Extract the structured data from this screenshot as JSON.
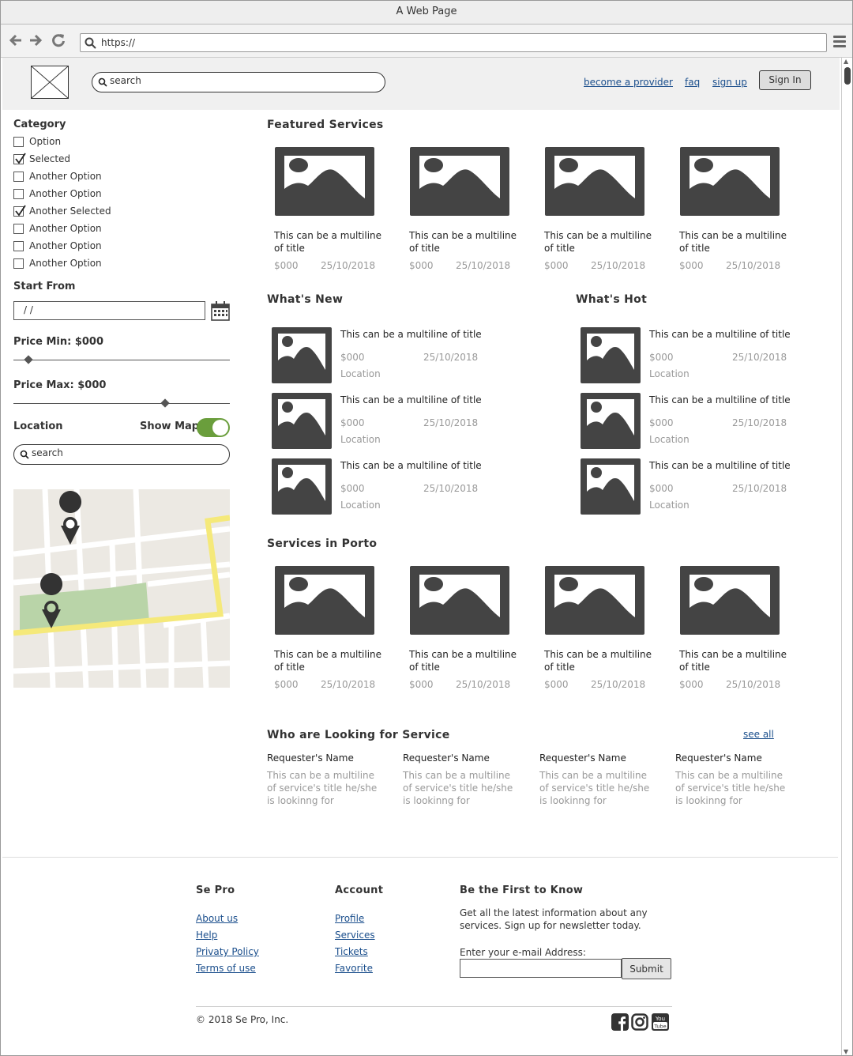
{
  "browser": {
    "title": "A Web Page",
    "url": "https://"
  },
  "header": {
    "search_placeholder": "search",
    "links": [
      "become a provider",
      "faq",
      "sign up"
    ],
    "signin_label": "Sign In"
  },
  "sidebar": {
    "category_heading": "Category",
    "options": [
      {
        "label": "Option",
        "checked": false
      },
      {
        "label": "Selected",
        "checked": true
      },
      {
        "label": "Another Option",
        "checked": false
      },
      {
        "label": "Another Option",
        "checked": false
      },
      {
        "label": "Another Selected",
        "checked": true
      },
      {
        "label": "Another Option",
        "checked": false
      },
      {
        "label": "Another Option",
        "checked": false
      },
      {
        "label": "Another Option",
        "checked": false
      }
    ],
    "start_from_heading": "Start From",
    "date_value": "/ /",
    "price_min_label": "Price Min: $000",
    "price_min_level": 0.07,
    "price_max_label": "Price Max: $000",
    "price_max_level": 0.7,
    "location_heading": "Location",
    "show_map_label": "Show Map",
    "show_map_on": true,
    "location_placeholder": "search"
  },
  "featured": {
    "heading": "Featured Services",
    "cards": [
      {
        "title": "This can be a multiline of title",
        "price": "$000",
        "date": "25/10/2018"
      },
      {
        "title": "This can be a multiline of title",
        "price": "$000",
        "date": "25/10/2018"
      },
      {
        "title": "This can be a multiline of title",
        "price": "$000",
        "date": "25/10/2018"
      },
      {
        "title": "This can be a multiline of title",
        "price": "$000",
        "date": "25/10/2018"
      }
    ]
  },
  "whats_new": {
    "heading": "What's New",
    "items": [
      {
        "title": "This can be a multiline of title",
        "price": "$000",
        "date": "25/10/2018",
        "location": "Location"
      },
      {
        "title": "This can be a multiline of title",
        "price": "$000",
        "date": "25/10/2018",
        "location": "Location"
      },
      {
        "title": "This can be a multiline of title",
        "price": "$000",
        "date": "25/10/2018",
        "location": "Location"
      }
    ]
  },
  "whats_hot": {
    "heading": "What's Hot",
    "items": [
      {
        "title": "This can be a multiline of title",
        "price": "$000",
        "date": "25/10/2018",
        "location": "Location"
      },
      {
        "title": "This can be a multiline of title",
        "price": "$000",
        "date": "25/10/2018",
        "location": "Location"
      },
      {
        "title": "This can be a multiline of title",
        "price": "$000",
        "date": "25/10/2018",
        "location": "Location"
      }
    ]
  },
  "porto": {
    "heading": "Services in Porto",
    "cards": [
      {
        "title": "This can be a multiline of title",
        "price": "$000",
        "date": "25/10/2018"
      },
      {
        "title": "This can be a multiline of title",
        "price": "$000",
        "date": "25/10/2018"
      },
      {
        "title": "This can be a multiline of title",
        "price": "$000",
        "date": "25/10/2018"
      },
      {
        "title": "This can be a multiline of title",
        "price": "$000",
        "date": "25/10/2018"
      }
    ]
  },
  "requests": {
    "heading": "Who are Looking for Service",
    "see_all": "see all",
    "items": [
      {
        "name": "Requester's Name",
        "desc": "This can be a multiline of service's title he/she is lookinng for"
      },
      {
        "name": "Requester's Name",
        "desc": "This can be a multiline of service's title he/she is lookinng for"
      },
      {
        "name": "Requester's Name",
        "desc": "This can be a multiline of service's title he/she is lookinng for"
      },
      {
        "name": "Requester's Name",
        "desc": "This can be a multiline of service's title he/she is lookinng for"
      }
    ]
  },
  "footer": {
    "col1_heading": "Se Pro",
    "col1_links": [
      "About us",
      "Help",
      "Privaty Policy",
      "Terms of use"
    ],
    "col2_heading": "Account",
    "col2_links": [
      "Profile",
      "Services",
      "Tickets",
      "Favorite"
    ],
    "newsletter_heading": "Be the First to Know",
    "newsletter_text": "Get all the latest information about any services. Sign up for newsletter today.",
    "email_label": "Enter your e-mail Address:",
    "submit_label": "Submit",
    "copyright": "© 2018 Se Pro, Inc.",
    "social_icons": [
      "facebook-icon",
      "instagram-icon",
      "youtube-icon"
    ]
  },
  "colors": {
    "link": "#1a4e8c",
    "toggle_on": "#6a9e3c",
    "image_placeholder": "#444444",
    "map_road_main": "#f5e97a",
    "map_park": "#b9d4a8"
  }
}
